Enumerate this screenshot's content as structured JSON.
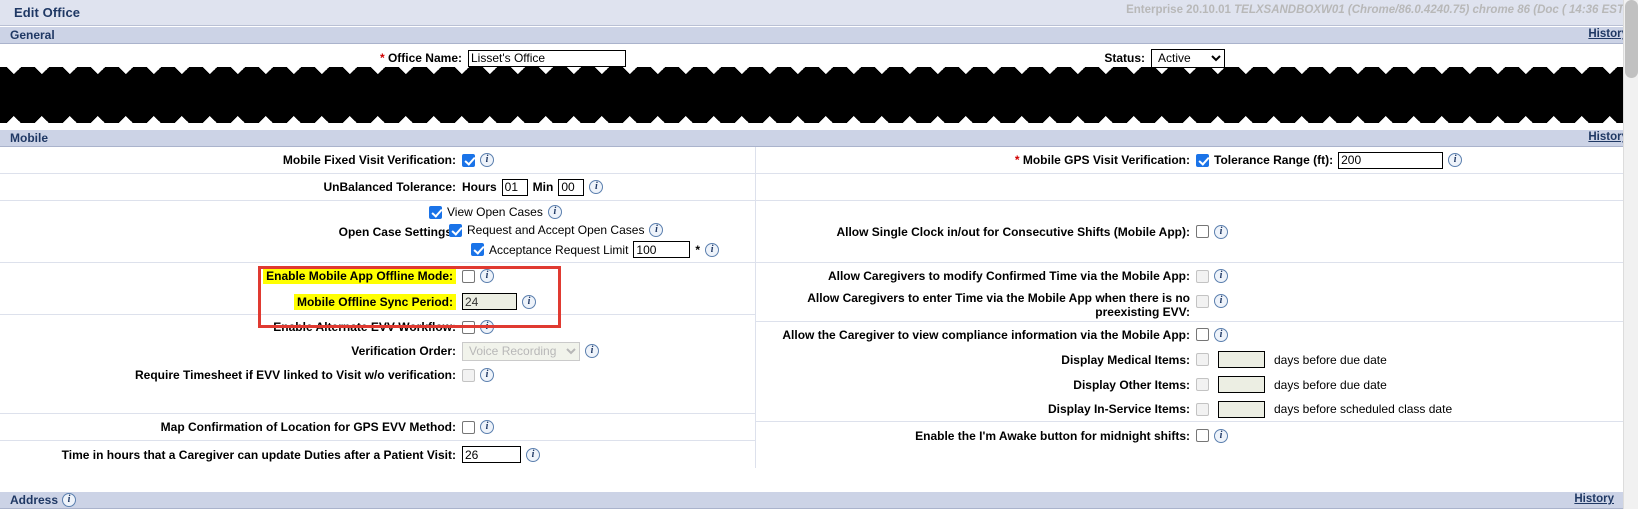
{
  "window": {
    "title": "Edit Office",
    "env_version": "Enterprise 20.10.01",
    "env_detail": "TELXSANDBOXW01 (Chrome/86.0.4240.75) chrome 86 (Doc ( 14:36 EST"
  },
  "icons": {
    "info": "i",
    "required": "*"
  },
  "sections": {
    "general": {
      "title": "General",
      "history": "History"
    },
    "mobile": {
      "title": "Mobile",
      "history": "History"
    },
    "address": {
      "title": "Address",
      "history": "History"
    }
  },
  "general": {
    "office_name_label": "Office Name:",
    "office_name_value": "Lisset's Office",
    "status_label": "Status:",
    "status_value": "Active",
    "status_options": [
      "Active"
    ]
  },
  "mobile_left": {
    "fixed_visit_label": "Mobile Fixed Visit Verification:",
    "fixed_visit_checked": true,
    "unbalanced_label": "UnBalanced Tolerance:",
    "unbalanced_hours_label": "Hours",
    "unbalanced_hours_value": "01",
    "unbalanced_min_label": "Min",
    "unbalanced_min_value": "00",
    "open_case_settings_label": "Open Case Settings:",
    "view_open_cases_label": "View Open Cases",
    "view_open_cases_checked": true,
    "request_accept_label": "Request and Accept Open Cases",
    "request_accept_checked": true,
    "acceptance_limit_label": "Acceptance Request Limit",
    "acceptance_limit_checked": true,
    "acceptance_limit_value": "100",
    "offline_mode_label": "Enable Mobile App Offline Mode:",
    "offline_mode_checked": false,
    "offline_sync_label": "Mobile Offline Sync Period:",
    "offline_sync_value": "24",
    "alt_evv_label": "Enable Alternate EVV Workflow:",
    "alt_evv_checked": false,
    "verification_order_label": "Verification Order:",
    "verification_order_value": "Voice Recording",
    "verification_order_options": [
      "Voice Recording"
    ],
    "require_timesheet_label": "Require Timesheet if EVV linked to Visit w/o verification:",
    "require_timesheet_checked": false,
    "map_confirmation_label": "Map Confirmation of Location for GPS EVV Method:",
    "map_confirmation_checked": false,
    "duties_update_label": "Time in hours that a Caregiver can update Duties after a Patient Visit:",
    "duties_update_value": "26"
  },
  "mobile_right": {
    "gps_visit_label": "Mobile GPS Visit Verification:",
    "gps_visit_checked": true,
    "tolerance_label": "Tolerance Range (ft):",
    "tolerance_value": "200",
    "single_clock_label": "Allow Single Clock in/out for Consecutive Shifts (Mobile App):",
    "single_clock_checked": false,
    "modify_confirmed_label": "Allow Caregivers to modify Confirmed Time via the Mobile App:",
    "modify_confirmed_checked": false,
    "enter_time_label": "Allow Caregivers to enter Time via the Mobile App when there is no preexisting EVV:",
    "enter_time_checked": false,
    "view_compliance_label": "Allow the Caregiver to view compliance information via the Mobile App:",
    "view_compliance_checked": false,
    "display_medical_label": "Display Medical Items:",
    "display_medical_checked": false,
    "display_medical_value": "",
    "display_medical_suffix": "days before due date",
    "display_other_label": "Display Other Items:",
    "display_other_checked": false,
    "display_other_value": "",
    "display_other_suffix": "days before due date",
    "display_inservice_label": "Display In-Service Items:",
    "display_inservice_checked": false,
    "display_inservice_value": "",
    "display_inservice_suffix": "days before scheduled class date",
    "im_awake_label": "Enable the I'm Awake button for midnight shifts:",
    "im_awake_checked": false
  },
  "colors": {
    "section_bar": "#ccd3e6",
    "title_bar": "#dfe3ef",
    "heading_text": "#1f3864",
    "checkbox_checked": "#1a73e8",
    "highlight": "#ffff00",
    "annotation_box": "#e03a31",
    "required_star": "#d00000"
  }
}
